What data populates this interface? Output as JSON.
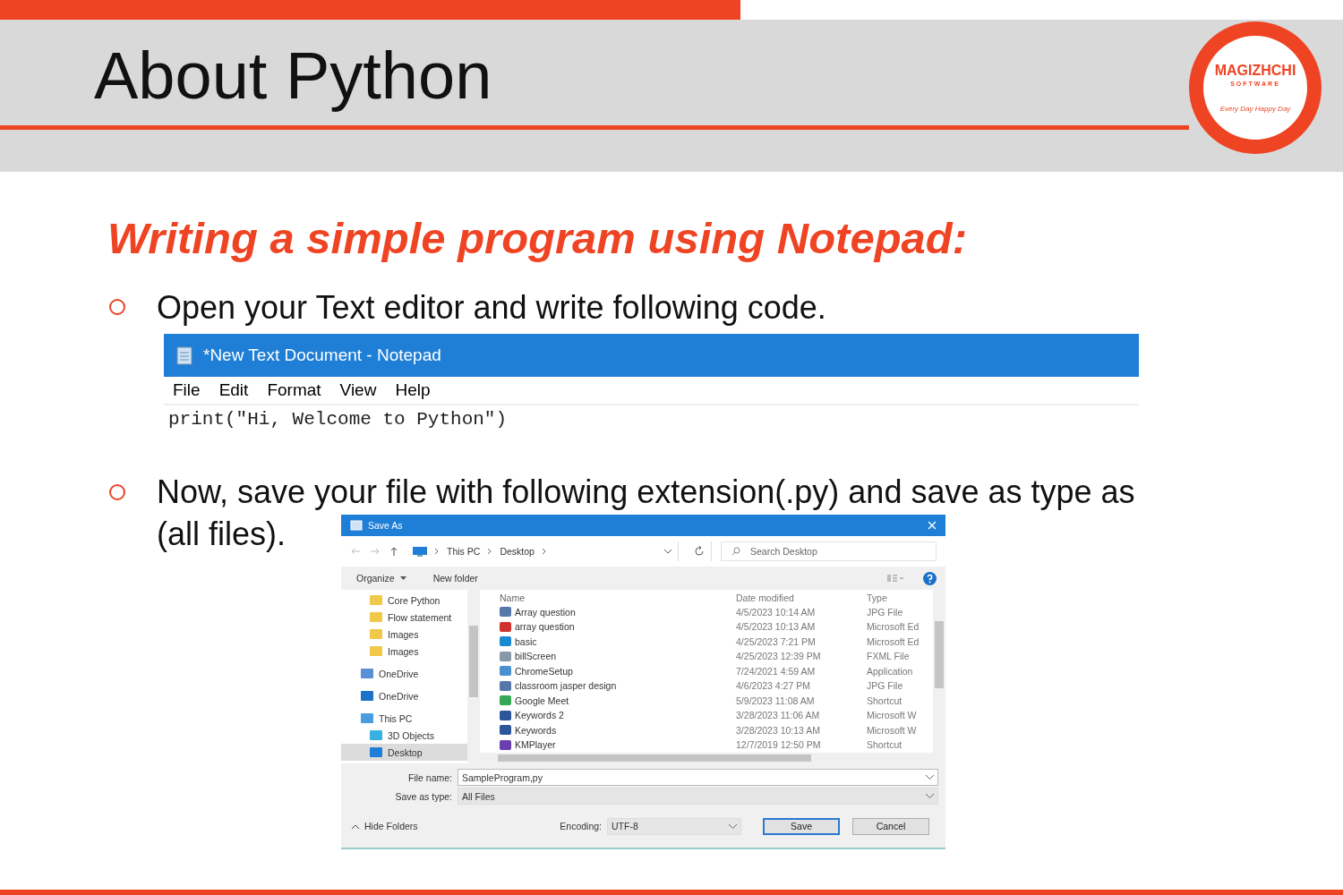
{
  "slide": {
    "title": "About Python",
    "subtitle": "Writing a simple program using Notepad:"
  },
  "logo": {
    "name": "MAGIZHCHI",
    "sub": "SOFTWARE",
    "tagline": "Every Day Happy Day"
  },
  "bullets": [
    {
      "lines": [
        "Open your Text editor and write following code."
      ]
    },
    {
      "lines": [
        "Now, save your file with following extension(.py) and save as type as",
        "(all files)."
      ]
    }
  ],
  "notepad": {
    "title": "*New Text Document - Notepad",
    "menu": [
      "File",
      "Edit",
      "Format",
      "View",
      "Help"
    ],
    "code": "print(\"Hi, Welcome to Python\")"
  },
  "dialog": {
    "title": "Save As",
    "breadcrumb": [
      "This PC",
      "Desktop"
    ],
    "search": {
      "placeholder": "Search Desktop"
    },
    "toolbar": [
      "Organize",
      "New folder"
    ],
    "nav": [
      {
        "label": "Core Python",
        "kind": "folder",
        "selected": false
      },
      {
        "label": "Flow statement",
        "kind": "folder",
        "selected": false
      },
      {
        "label": "Images",
        "kind": "folder",
        "selected": false
      },
      {
        "label": "Images",
        "kind": "folder",
        "selected": false
      },
      {
        "label": "OneDrive",
        "kind": "drive",
        "selected": false
      },
      {
        "label": "OneDrive",
        "kind": "cloud",
        "selected": false
      },
      {
        "label": "This PC",
        "kind": "pc",
        "selected": false
      },
      {
        "label": "3D Objects",
        "kind": "cube",
        "selected": false
      },
      {
        "label": "Desktop",
        "kind": "desktop",
        "selected": true
      }
    ],
    "columns": [
      "Name",
      "Date modified",
      "Type"
    ],
    "files": [
      {
        "name": "Array question",
        "kind": "image",
        "date": "4/5/2023 10:14 AM",
        "type": "JPG File"
      },
      {
        "name": "array question",
        "kind": "pdf",
        "date": "4/5/2023 10:13 AM",
        "type": "Microsoft Ed"
      },
      {
        "name": "basic",
        "kind": "edge",
        "date": "4/25/2023 7:21 PM",
        "type": "Microsoft Ed"
      },
      {
        "name": "billScreen",
        "kind": "doc",
        "date": "4/25/2023 12:39 PM",
        "type": "FXML File"
      },
      {
        "name": "ChromeSetup",
        "kind": "setup",
        "date": "7/24/2021 4:59 AM",
        "type": "Application"
      },
      {
        "name": "classroom jasper design",
        "kind": "image",
        "date": "4/6/2023 4:27 PM",
        "type": "JPG File"
      },
      {
        "name": "Google Meet",
        "kind": "meet",
        "date": "5/9/2023 11:08 AM",
        "type": "Shortcut"
      },
      {
        "name": "Keywords 2",
        "kind": "word",
        "date": "3/28/2023 11:06 AM",
        "type": "Microsoft W"
      },
      {
        "name": "Keywords",
        "kind": "word",
        "date": "3/28/2023 10:13 AM",
        "type": "Microsoft W"
      },
      {
        "name": "KMPlayer",
        "kind": "player",
        "date": "12/7/2019 12:50 PM",
        "type": "Shortcut"
      }
    ],
    "file_name_label": "File name:",
    "file_name": "SampleProgram,py",
    "type_label": "Save as type:",
    "type_value": "All Files",
    "hide_folders": "Hide Folders",
    "encoding_label": "Encoding:",
    "encoding": "UTF-8",
    "buttons": [
      "Save",
      "Cancel"
    ]
  }
}
